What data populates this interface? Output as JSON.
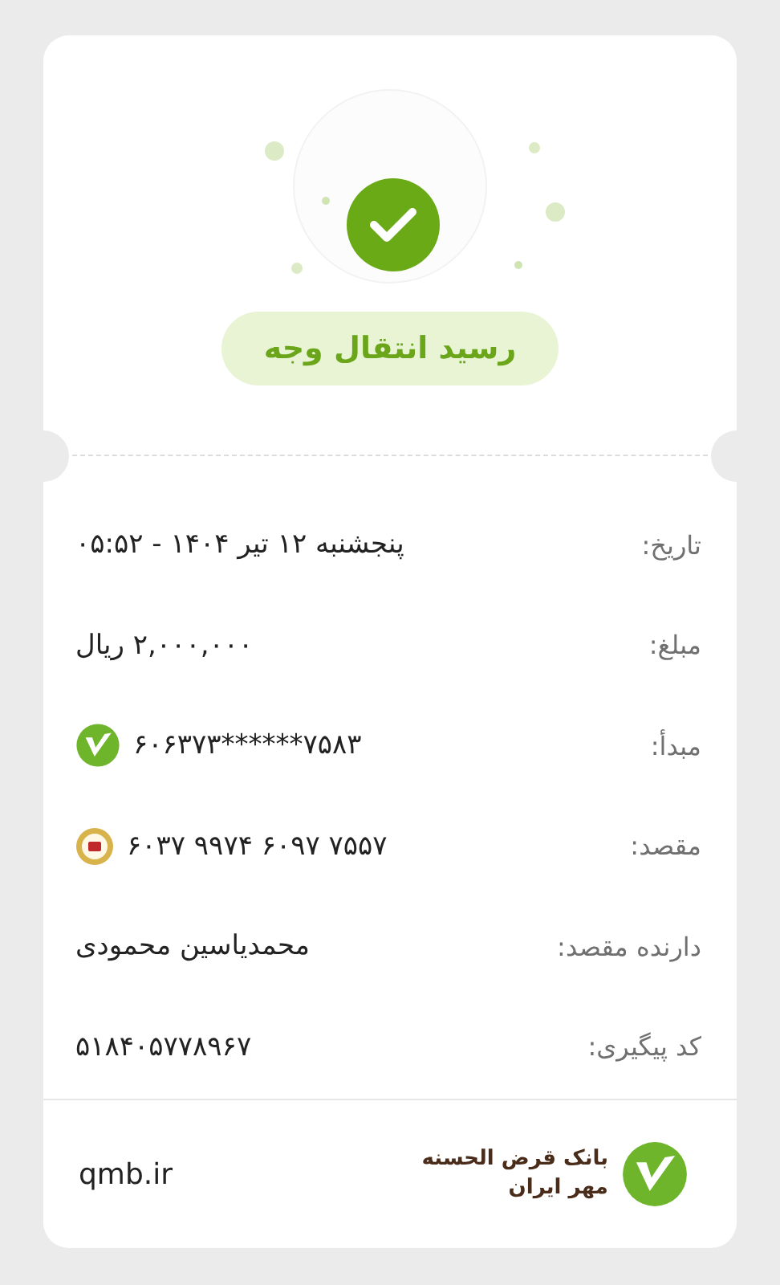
{
  "status": {
    "title": "رسید انتقال وجه"
  },
  "rows": [
    {
      "label": "تاریخ:",
      "value": "پنجشنبه ۱۲ تیر ۱۴۰۴ - ۰۵:۵۲",
      "kind": "text"
    },
    {
      "label": "مبلغ:",
      "value": "۲,۰۰۰,۰۰۰ ریال",
      "kind": "text"
    },
    {
      "label": "مبدأ:",
      "value": "۶۰۶۳۷۳******۷۵۸۳",
      "kind": "card_mehr"
    },
    {
      "label": "مقصد:",
      "value": "۶۰۳۷ ۹۹۷۴ ۶۰۹۷ ۷۵۵۷",
      "kind": "card_melli"
    },
    {
      "label": "دارنده مقصد:",
      "value": "محمدیاسین محمودی",
      "kind": "text"
    },
    {
      "label": "کد پیگیری:",
      "value": "۵۱۸۴۰۵۷۷۸۹۶۷",
      "kind": "text"
    }
  ],
  "footer": {
    "bank_name": [
      "بانک قرض الحسنه",
      "مهر ایران"
    ],
    "website": "qmb.ir"
  }
}
